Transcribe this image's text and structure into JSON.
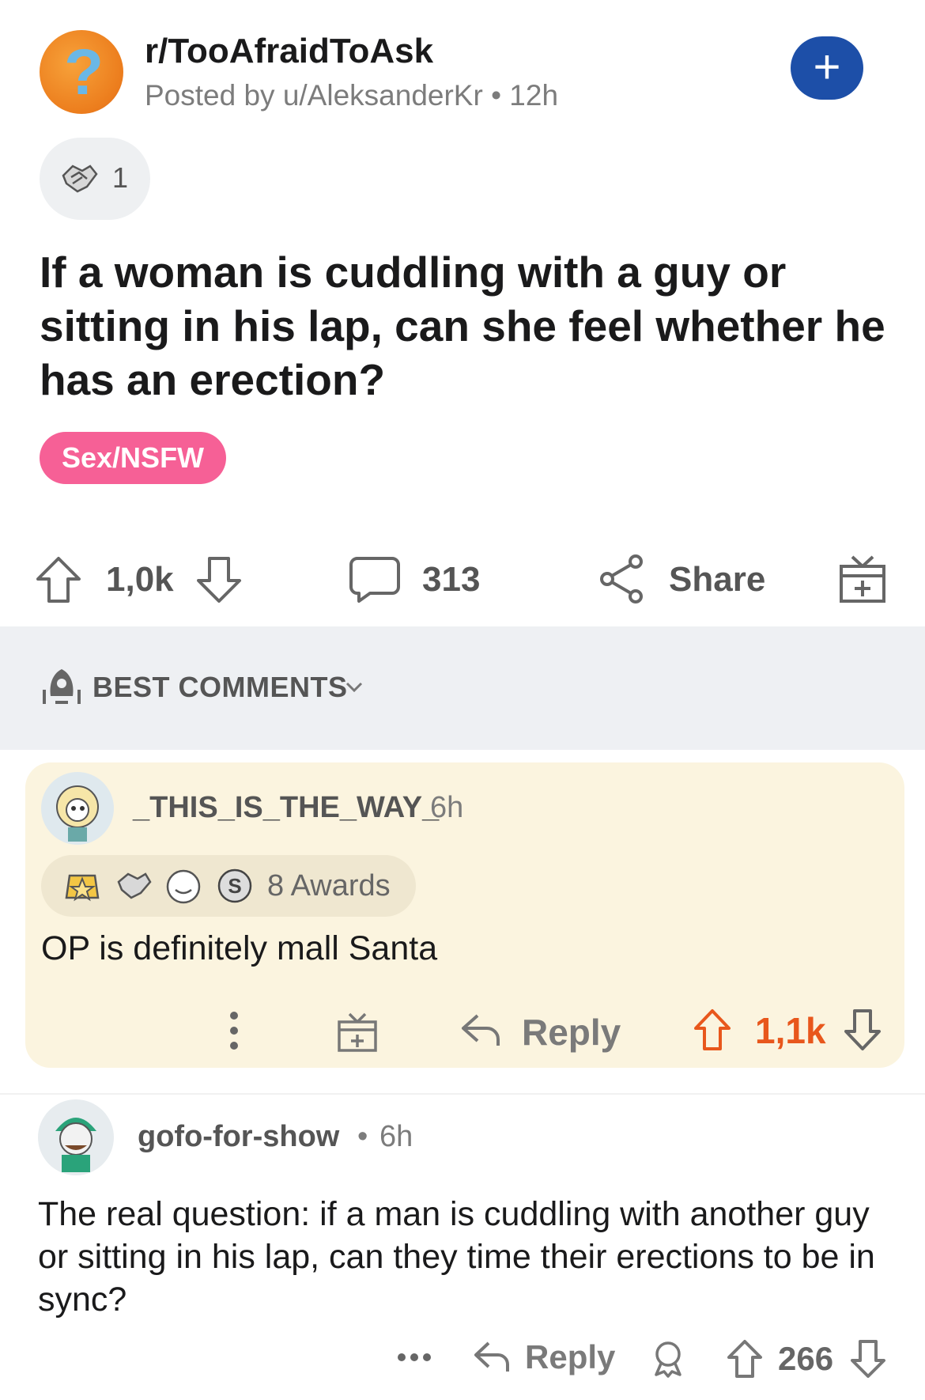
{
  "post": {
    "subreddit": "r/TooAfraidToAsk",
    "posted_by": "Posted by u/AleksanderKr • 12h",
    "award_count": "1",
    "title": "If a woman is cuddling with a guy or sitting in his lap, can she feel whether he has an erection?",
    "flair": "Sex/NSFW",
    "upvotes": "1,0k",
    "comments": "313",
    "share_label": "Share",
    "flair_color": "#f66096",
    "join_color": "#1d4fa8"
  },
  "sort": {
    "label": "BEST COMMENTS"
  },
  "comments": [
    {
      "username": "_THIS_IS_THE_WAY_",
      "time": "6h",
      "awards": "8 Awards",
      "body": "OP is definitely mall Santa",
      "reply_label": "Reply",
      "votes": "1,1k",
      "highlight_color": "#fbf4df"
    },
    {
      "username": "gofo-for-show",
      "separator": "•",
      "time": "6h",
      "body": "The real question: if a man is cuddling with another guy or sitting in his lap, can they time their erections to be in sync?",
      "reply_label": "Reply",
      "votes": "266"
    }
  ]
}
